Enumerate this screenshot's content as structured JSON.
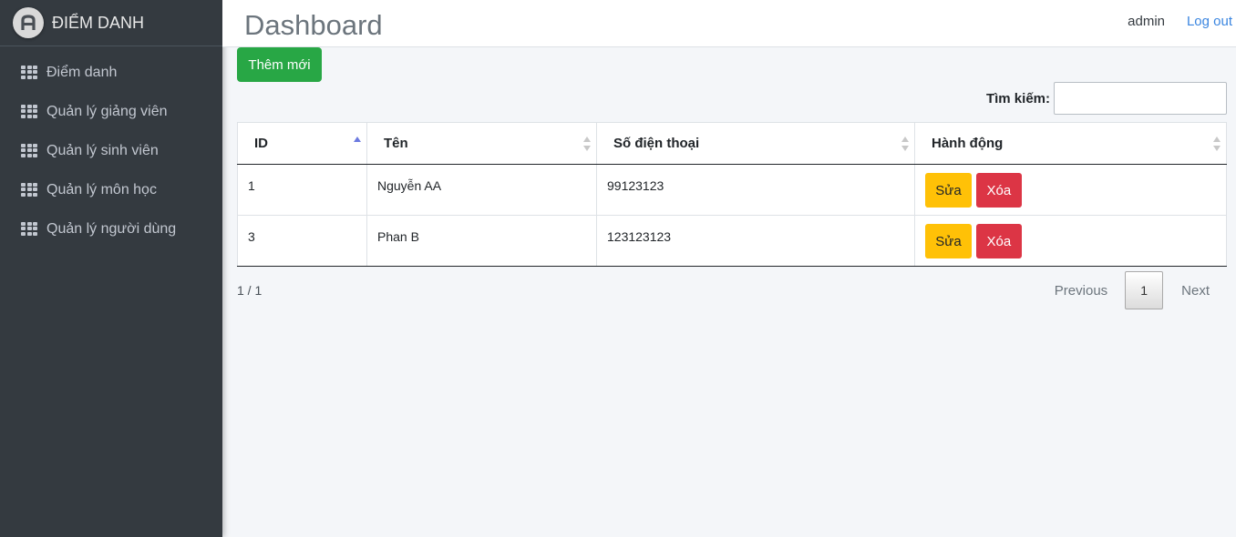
{
  "brand": {
    "name": "ĐIỂM DANH",
    "logo_icon": "brand-logo-icon"
  },
  "sidebar": {
    "items": [
      {
        "label": "Điểm danh",
        "icon": "grid-icon"
      },
      {
        "label": "Quản lý giảng viên",
        "icon": "grid-icon"
      },
      {
        "label": "Quản lý sinh viên",
        "icon": "grid-icon"
      },
      {
        "label": "Quản lý môn học",
        "icon": "grid-icon"
      },
      {
        "label": "Quản lý người dùng",
        "icon": "grid-icon"
      }
    ]
  },
  "header": {
    "title": "Dashboard",
    "user": "admin",
    "logout_label": "Log out"
  },
  "toolbar": {
    "add_label": "Thêm mới",
    "search_label": "Tìm kiếm:",
    "search_value": ""
  },
  "table": {
    "columns": [
      "ID",
      "Tên",
      "Số điện thoại",
      "Hành động"
    ],
    "sorted_column": "ID",
    "sort_direction": "ascending",
    "rows": [
      {
        "id": "1",
        "name": "Nguyễn AA",
        "phone": "99123123",
        "edit_label": "Sửa",
        "delete_label": "Xóa"
      },
      {
        "id": "3",
        "name": "Phan B",
        "phone": "123123123",
        "edit_label": "Sửa",
        "delete_label": "Xóa"
      }
    ]
  },
  "pagination": {
    "info": "1 / 1",
    "previous_label": "Previous",
    "current_page": "1",
    "next_label": "Next"
  },
  "colors": {
    "sidebar_bg": "#343a40",
    "add_button": "#28a745",
    "edit_button": "#ffc107",
    "delete_button": "#dc3545",
    "link": "#3b86e0"
  }
}
